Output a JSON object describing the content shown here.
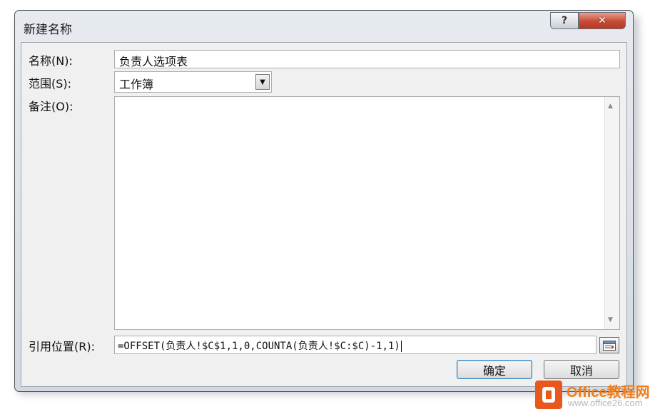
{
  "window": {
    "title": "新建名称",
    "help_glyph": "?",
    "close_glyph": "✕"
  },
  "form": {
    "name_label": "名称(N):",
    "name_value": "负责人选项表",
    "scope_label": "范围(S):",
    "scope_value": "工作簿",
    "comment_label": "备注(O):",
    "comment_value": "",
    "refers_to_label": "引用位置(R):",
    "refers_to_value": "=OFFSET(负责人!$C$1,1,0,COUNTA(负责人!$C:$C)-1,1)"
  },
  "buttons": {
    "ok_label": "确定",
    "cancel_label": "取消"
  },
  "watermark": {
    "brand": "Office教程网",
    "url": "www.office26.com"
  }
}
